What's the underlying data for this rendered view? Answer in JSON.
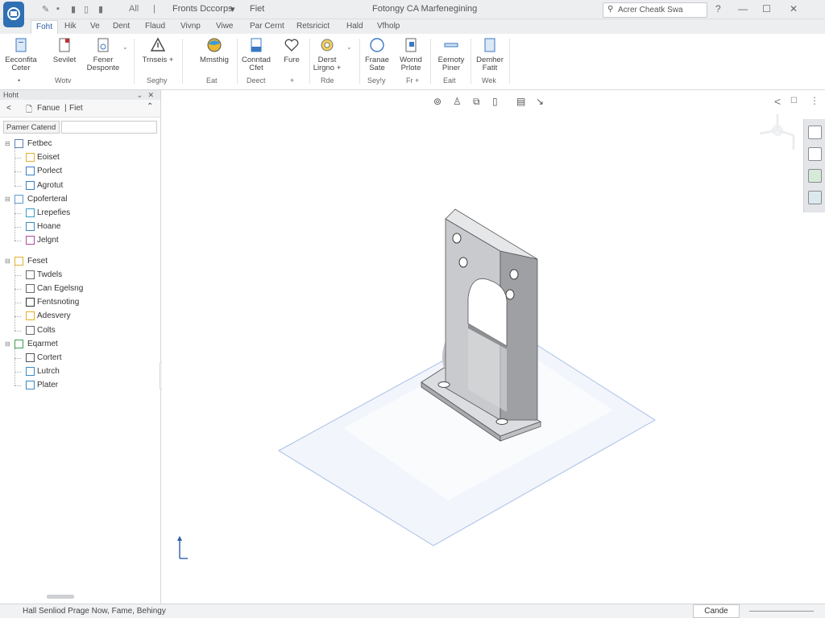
{
  "titlebar": {
    "quick_access": [
      "All"
    ],
    "doc_menu": "Fronts Dccorps",
    "doc_menu_caret": "▾",
    "doc_name": "Fiet",
    "app_title": "Fotongy CA Marfenegining",
    "search_placeholder": "Acrer Cheatk Swa",
    "window_controls": [
      "?",
      "—",
      "☐",
      "✕"
    ]
  },
  "menu_tabs": [
    {
      "label": "Foht",
      "active": true
    },
    {
      "label": "Hik",
      "active": false
    },
    {
      "label": "Ve",
      "active": false
    },
    {
      "label": "Dent",
      "active": false
    },
    {
      "label": "Flaud",
      "active": false
    },
    {
      "label": "Vivnp",
      "active": false
    },
    {
      "label": "Viwe",
      "active": false
    },
    {
      "label": "Par Cernt",
      "active": false
    },
    {
      "label": "Retsricict",
      "active": false
    },
    {
      "label": "Hald",
      "active": false
    },
    {
      "label": "Vfholp",
      "active": false
    }
  ],
  "ribbon": {
    "buttons": [
      {
        "label1": "Eeconfita",
        "label2": "Ceter",
        "icon": "page-icon"
      },
      {
        "label1": "Sevilet",
        "label2": "",
        "icon": "page-icon"
      },
      {
        "label1": "Fener",
        "label2": "Desponte",
        "icon": "page-icon"
      },
      {
        "label1": "Trnseis +",
        "label2": "",
        "icon": "warning-icon"
      },
      {
        "label1": "Mmsthig",
        "label2": "",
        "icon": "globe-icon"
      },
      {
        "label1": "Conntad",
        "label2": "Cfet",
        "icon": "doc-icon"
      },
      {
        "label1": "Fure",
        "label2": "",
        "icon": "heart-icon"
      },
      {
        "label1": "Derst",
        "label2": "Lirgno +",
        "icon": "gear-icon"
      },
      {
        "label1": "Franae",
        "label2": "Sate",
        "icon": "circle-icon"
      },
      {
        "label1": "Wornd",
        "label2": "Prlote",
        "icon": "doc-icon"
      },
      {
        "label1": "Eernoty",
        "label2": "Piner",
        "icon": "bar-icon"
      },
      {
        "label1": "Demher",
        "label2": "Fatit",
        "icon": "page-icon"
      }
    ],
    "group_labels": [
      "•",
      "Wotv",
      "Seghy",
      "Eat",
      "Deect",
      "+",
      "Rde",
      "Sey!y",
      "Fr +",
      "Eait",
      "Wek"
    ]
  },
  "left_panel": {
    "header": "Hoht",
    "nav_back": "<",
    "nav_title1": "Fanue",
    "nav_title2": "Fiet",
    "filter_label": "Pamer Catend",
    "tree": [
      {
        "label": "Fetbec",
        "level": 0,
        "icon_color": "#5a7fb5"
      },
      {
        "label": "Eoiset",
        "level": 1,
        "icon_color": "#e0b030"
      },
      {
        "label": "Porlect",
        "level": 1,
        "icon_color": "#3a7dc4"
      },
      {
        "label": "Agrotut",
        "level": 1,
        "icon_color": "#3a7dc4"
      },
      {
        "label": "Cpoferteral",
        "level": 0,
        "icon_color": "#5a9ad0"
      },
      {
        "label": "Lrepefies",
        "level": 1,
        "icon_color": "#3a9ac4"
      },
      {
        "label": "Hoane",
        "level": 1,
        "icon_color": "#3a8ac4"
      },
      {
        "label": "Jelgnt",
        "level": 1,
        "icon_color": "#b04a9a"
      },
      {
        "label": "Feset",
        "level": 0,
        "icon_color": "#e0b030"
      },
      {
        "label": "Twdels",
        "level": 1,
        "icon_color": "#666666"
      },
      {
        "label": "Can Egelsng",
        "level": 1,
        "icon_color": "#666666"
      },
      {
        "label": "Fentsnoting",
        "level": 1,
        "icon_color": "#333333"
      },
      {
        "label": "Adesvery",
        "level": 1,
        "icon_color": "#e8b020"
      },
      {
        "label": "Colts",
        "level": 1,
        "icon_color": "#666666"
      },
      {
        "label": "Eqarmet",
        "level": 0,
        "icon_color": "#3aa050"
      },
      {
        "label": "Cortert",
        "level": 1,
        "icon_color": "#555555"
      },
      {
        "label": "Lutrch",
        "level": 1,
        "icon_color": "#3a8ac4"
      },
      {
        "label": "Plater",
        "level": 1,
        "icon_color": "#3a8ac4"
      }
    ]
  },
  "viewport": {
    "toolbar_icons": [
      "view-cube-icon",
      "user-icon",
      "section-icon",
      "display-icon",
      "render-icon",
      "arrow-icon"
    ],
    "corner_icons": [
      "<",
      "☐",
      "⋮"
    ]
  },
  "statusbar": {
    "text": "Hall Senliod Prage Now, Fame, Behingy",
    "cancel_label": "Cande"
  }
}
